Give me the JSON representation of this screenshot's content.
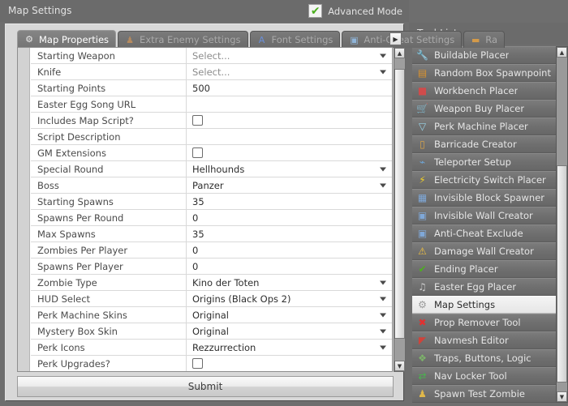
{
  "window": {
    "title": "Map Settings",
    "advanced_mode": {
      "label": "Advanced Mode",
      "checked": true,
      "check_glyph": "✔"
    },
    "controls": {
      "minimize": "—",
      "maximize": "□",
      "close": "✕"
    }
  },
  "tabs": {
    "more_glyph": "▶",
    "items": [
      {
        "label": "Map Properties",
        "icon": "gear-icon",
        "glyph": "⚙",
        "color": "#e8e8e8",
        "active": true
      },
      {
        "label": "Extra Enemy Settings",
        "icon": "enemy-icon",
        "glyph": "♟",
        "color": "#b58a5e",
        "active": false
      },
      {
        "label": "Font Settings",
        "icon": "font-icon",
        "glyph": "A",
        "color": "#6a8fd8",
        "active": false
      },
      {
        "label": "Anti-Cheat Settings",
        "icon": "anti-cheat-icon",
        "glyph": "▣",
        "color": "#8fb4d8",
        "active": false
      },
      {
        "label": "Ra",
        "icon": "random-box-icon",
        "glyph": "▬",
        "color": "#d49a4a",
        "active": false
      }
    ]
  },
  "grid": {
    "rows": [
      {
        "name": "Starting Weapon",
        "type": "select",
        "value": "Select...",
        "placeholder": true
      },
      {
        "name": "Knife",
        "type": "select",
        "value": "Select...",
        "placeholder": true
      },
      {
        "name": "Starting Points",
        "type": "text",
        "value": "500"
      },
      {
        "name": "Easter Egg Song URL",
        "type": "text",
        "value": ""
      },
      {
        "name": "Includes Map Script?",
        "type": "checkbox",
        "value": "",
        "checked": false
      },
      {
        "name": "Script Description",
        "type": "text",
        "value": ""
      },
      {
        "name": "GM Extensions",
        "type": "checkbox",
        "value": "",
        "checked": false
      },
      {
        "name": "Special Round",
        "type": "select",
        "value": "Hellhounds"
      },
      {
        "name": "Boss",
        "type": "select",
        "value": "Panzer"
      },
      {
        "name": "Starting Spawns",
        "type": "text",
        "value": "35"
      },
      {
        "name": "Spawns Per Round",
        "type": "text",
        "value": "0"
      },
      {
        "name": "Max Spawns",
        "type": "text",
        "value": "35"
      },
      {
        "name": "Zombies Per Player",
        "type": "text",
        "value": "0"
      },
      {
        "name": "Spawns Per Player",
        "type": "text",
        "value": "0"
      },
      {
        "name": "Zombie Type",
        "type": "select",
        "value": "Kino der Toten"
      },
      {
        "name": "HUD Select",
        "type": "select",
        "value": "Origins (Black Ops 2)"
      },
      {
        "name": "Perk Machine Skins",
        "type": "select",
        "value": "Original"
      },
      {
        "name": "Mystery Box Skin",
        "type": "select",
        "value": "Original"
      },
      {
        "name": "Perk Icons",
        "type": "select",
        "value": "Rezzurrection"
      },
      {
        "name": "Perk Upgrades?",
        "type": "checkbox",
        "value": "",
        "checked": false
      }
    ],
    "scroll_up_glyph": "▲",
    "scroll_down_glyph": "▼"
  },
  "submit": {
    "label": "Submit"
  },
  "toolpanel": {
    "title": "Tool List",
    "scroll_up_glyph": "▲",
    "scroll_down_glyph": "▼",
    "items": [
      {
        "label": "Buildable Placer",
        "icon": "screwdriver-icon",
        "glyph": "🔧",
        "color": "#5a9bd5",
        "selected": false
      },
      {
        "label": "Random Box Spawnpoint",
        "icon": "chest-icon",
        "glyph": "▤",
        "color": "#d9922e",
        "selected": false
      },
      {
        "label": "Workbench Placer",
        "icon": "workbench-icon",
        "glyph": "■",
        "color": "#cf4b4b",
        "selected": false
      },
      {
        "label": "Weapon Buy Placer",
        "icon": "cart-icon",
        "glyph": "🛒",
        "color": "#cfcfcf",
        "selected": false
      },
      {
        "label": "Perk Machine Placer",
        "icon": "cocktail-icon",
        "glyph": "▽",
        "color": "#9ad4e8",
        "selected": false
      },
      {
        "label": "Barricade Creator",
        "icon": "door-icon",
        "glyph": "▯",
        "color": "#d8a349",
        "selected": false
      },
      {
        "label": "Teleporter Setup",
        "icon": "plug-icon",
        "glyph": "⌁",
        "color": "#6fa8dc",
        "selected": false
      },
      {
        "label": "Electricity Switch Placer",
        "icon": "lightning-icon",
        "glyph": "⚡",
        "color": "#f2d024",
        "selected": false
      },
      {
        "label": "Invisible Block Spawner",
        "icon": "block-icon",
        "glyph": "▦",
        "color": "#7fa8d8",
        "selected": false
      },
      {
        "label": "Invisible Wall Creator",
        "icon": "wall-icon",
        "glyph": "▣",
        "color": "#7fa8d8",
        "selected": false
      },
      {
        "label": "Anti-Cheat Exclude",
        "icon": "anti-cheat-icon",
        "glyph": "▣",
        "color": "#7fa8d8",
        "selected": false
      },
      {
        "label": "Damage Wall Creator",
        "icon": "warning-icon",
        "glyph": "⚠",
        "color": "#f0c040",
        "selected": false
      },
      {
        "label": "Ending Placer",
        "icon": "check-icon",
        "glyph": "✔",
        "color": "#4caf1f",
        "selected": false
      },
      {
        "label": "Easter Egg Placer",
        "icon": "music-note-icon",
        "glyph": "♫",
        "color": "#cdcdcd",
        "selected": false
      },
      {
        "label": "Map Settings",
        "icon": "gear-icon",
        "glyph": "⚙",
        "color": "#9a9a9a",
        "selected": true
      },
      {
        "label": "Prop Remover Tool",
        "icon": "delete-circle-icon",
        "glyph": "✖",
        "color": "#e03131",
        "selected": false
      },
      {
        "label": "Navmesh Editor",
        "icon": "navmesh-icon",
        "glyph": "◤",
        "color": "#d0433a",
        "selected": false
      },
      {
        "label": "Traps, Buttons, Logic",
        "icon": "gamepad-icon",
        "glyph": "❖",
        "color": "#7db36a",
        "selected": false
      },
      {
        "label": "Nav Locker Tool",
        "icon": "nav-locker-icon",
        "glyph": "⇄",
        "color": "#4caf50",
        "selected": false
      },
      {
        "label": "Spawn Test Zombie",
        "icon": "zombie-icon",
        "glyph": "♟",
        "color": "#e0b84a",
        "selected": false
      }
    ]
  }
}
